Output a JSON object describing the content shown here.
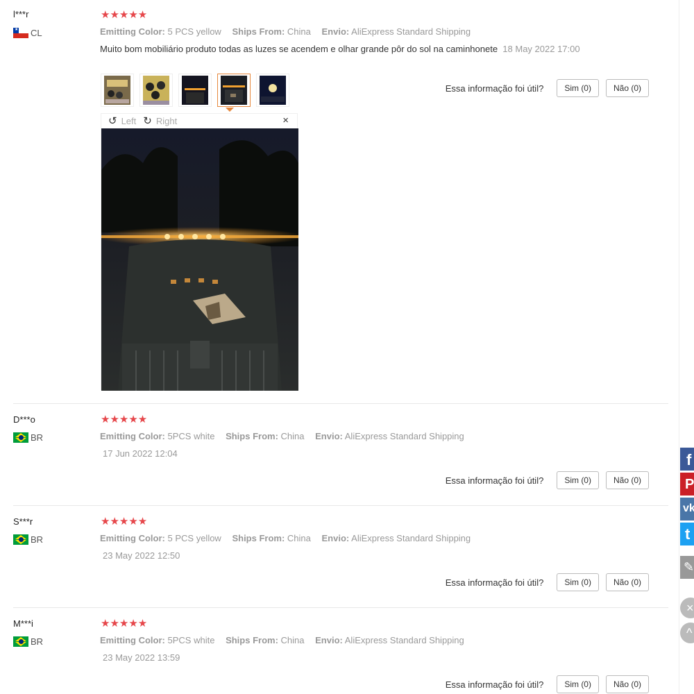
{
  "reviews": [
    {
      "user": "l***r",
      "country": "CL",
      "stars": "★★★★★",
      "emitting_label": "Emitting Color:",
      "emitting_value": "5 PCS yellow",
      "ships_label": "Ships From:",
      "ships_value": "China",
      "envio_label": "Envio:",
      "envio_value": "AliExpress Standard Shipping",
      "text": "Muito bom mobiliário produto todas as luzes se acendem e olhar grande pôr do sol na caminhonete",
      "date": "18 May 2022 17:00",
      "helpful_question": "Essa informação foi útil?",
      "yes_label": "Sim (0)",
      "no_label": "Não (0)",
      "viewer": {
        "rotate_left_label": "Left",
        "rotate_right_label": "Right",
        "close_symbol": "×"
      }
    },
    {
      "user": "D***o",
      "country": "BR",
      "stars": "★★★★★",
      "emitting_label": "Emitting Color:",
      "emitting_value": "5PCS white",
      "ships_label": "Ships From:",
      "ships_value": "China",
      "envio_label": "Envio:",
      "envio_value": "AliExpress Standard Shipping",
      "date": "17 Jun 2022 12:04",
      "helpful_question": "Essa informação foi útil?",
      "yes_label": "Sim (0)",
      "no_label": "Não (0)"
    },
    {
      "user": "S***r",
      "country": "BR",
      "stars": "★★★★★",
      "emitting_label": "Emitting Color:",
      "emitting_value": "5 PCS yellow",
      "ships_label": "Ships From:",
      "ships_value": "China",
      "envio_label": "Envio:",
      "envio_value": "AliExpress Standard Shipping",
      "date": "23 May 2022 12:50",
      "helpful_question": "Essa informação foi útil?",
      "yes_label": "Sim (0)",
      "no_label": "Não (0)"
    },
    {
      "user": "M***i",
      "country": "BR",
      "stars": "★★★★★",
      "emitting_label": "Emitting Color:",
      "emitting_value": "5PCS white",
      "ships_label": "Ships From:",
      "ships_value": "China",
      "envio_label": "Envio:",
      "envio_value": "AliExpress Standard Shipping",
      "date": "23 May 2022 13:59",
      "helpful_question": "Essa informação foi útil?",
      "yes_label": "Sim (0)",
      "no_label": "Não (0)"
    }
  ],
  "social": [
    {
      "name": "facebook",
      "glyph": "f",
      "color": "#3b5998"
    },
    {
      "name": "pinterest",
      "glyph": "P",
      "color": "#cb2027"
    },
    {
      "name": "vk",
      "glyph": "vk",
      "color": "#4a76a8"
    },
    {
      "name": "twitter",
      "glyph": "t",
      "color": "#1da1f2"
    },
    {
      "name": "edit",
      "glyph": "✎",
      "color": "#999999"
    }
  ],
  "colors": {
    "star": "#e6474b",
    "active_thumb_border": "#e6873c"
  }
}
